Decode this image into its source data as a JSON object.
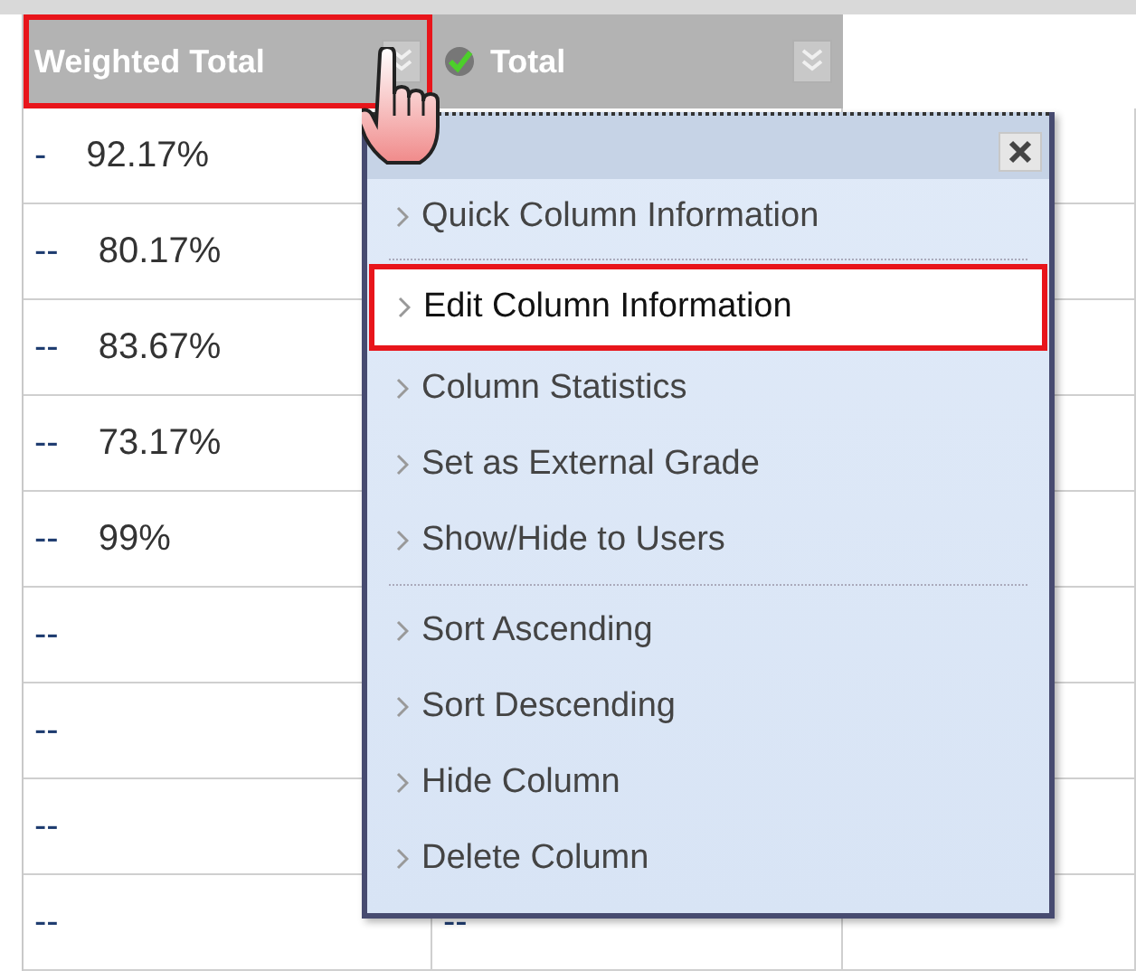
{
  "grid": {
    "columns": [
      {
        "label": "Weighted Total",
        "highlighted": true,
        "completed": false
      },
      {
        "label": "Total",
        "highlighted": false,
        "completed": true
      }
    ],
    "rows": [
      {
        "weighted_total": {
          "dash": "-",
          "value": "92.17%"
        }
      },
      {
        "weighted_total": {
          "dash": "--",
          "value": "80.17%"
        }
      },
      {
        "weighted_total": {
          "dash": "--",
          "value": "83.67%"
        }
      },
      {
        "weighted_total": {
          "dash": "--",
          "value": "73.17%"
        }
      },
      {
        "weighted_total": {
          "dash": "--",
          "value": "99%"
        }
      },
      {
        "weighted_total": {
          "dash": "--"
        }
      },
      {
        "weighted_total": {
          "dash": "--"
        }
      },
      {
        "weighted_total": {
          "dash": "--"
        }
      },
      {
        "weighted_total": {
          "dash": "--"
        },
        "total": {
          "dash": "--"
        }
      }
    ]
  },
  "context_menu": {
    "groups": [
      [
        {
          "label": "Quick Column Information",
          "selected": false
        }
      ],
      [
        {
          "label": "Edit Column Information",
          "selected": true
        },
        {
          "label": "Column Statistics",
          "selected": false
        },
        {
          "label": "Set as External Grade",
          "selected": false
        },
        {
          "label": "Show/Hide to Users",
          "selected": false
        }
      ],
      [
        {
          "label": "Sort Ascending",
          "selected": false
        },
        {
          "label": "Sort Descending",
          "selected": false
        },
        {
          "label": "Hide Column",
          "selected": false
        },
        {
          "label": "Delete Column",
          "selected": false
        }
      ]
    ]
  }
}
